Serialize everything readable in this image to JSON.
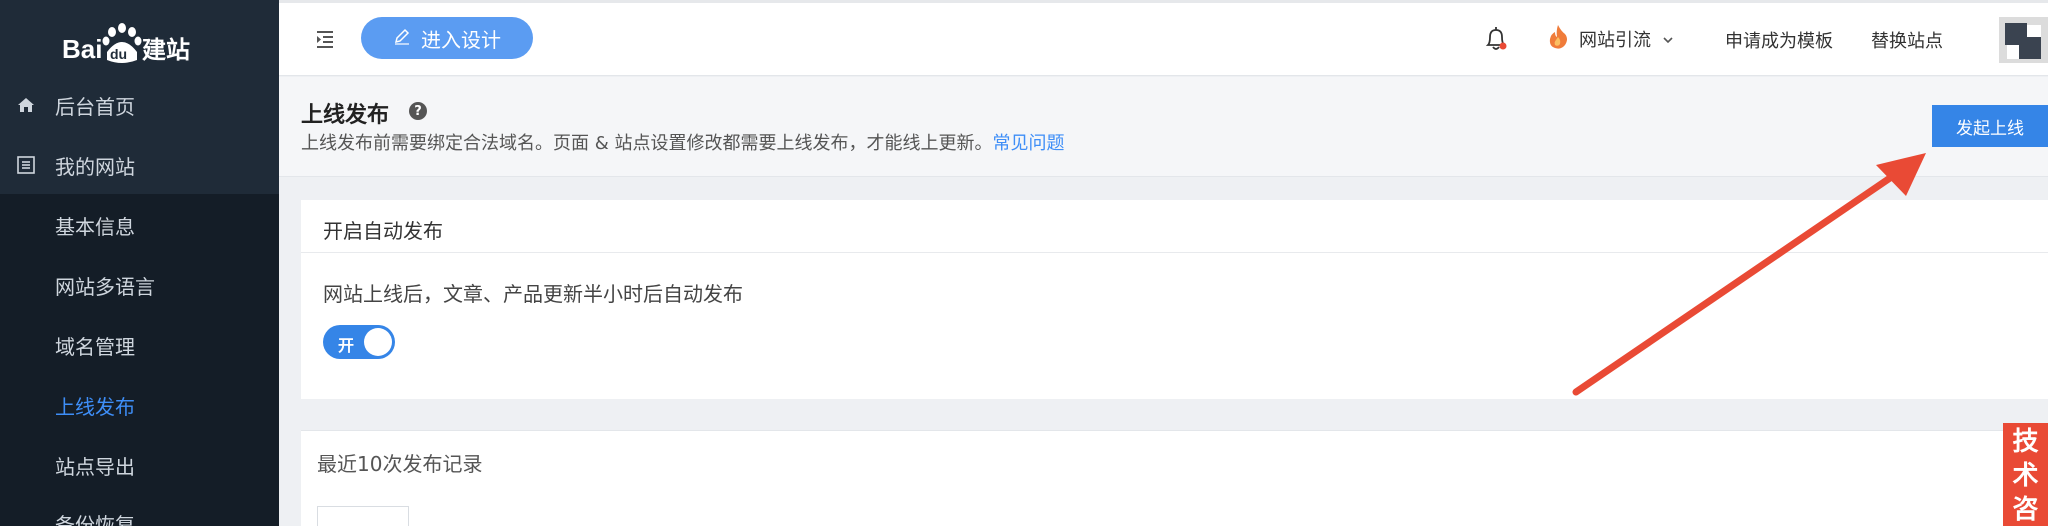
{
  "logo": {
    "text_left": "Bai",
    "text_paw": "du",
    "text_right": "建站"
  },
  "sidebar": {
    "items": [
      {
        "label": "后台首页",
        "icon": "home-icon"
      },
      {
        "label": "我的网站",
        "icon": "list-icon"
      }
    ],
    "subitems": [
      {
        "label": "基本信息"
      },
      {
        "label": "网站多语言"
      },
      {
        "label": "域名管理"
      },
      {
        "label": "上线发布",
        "active": true
      },
      {
        "label": "站点导出"
      },
      {
        "label": "备份恢复"
      }
    ]
  },
  "topbar": {
    "design_button": "进入设计",
    "traffic_label": "网站引流",
    "apply_template": "申请成为模板",
    "switch_site": "替换站点"
  },
  "page": {
    "title": "上线发布",
    "description": "上线发布前需要绑定合法域名。页面 & 站点设置修改都需要上线发布，才能线上更新。",
    "faq_link": "常见问题",
    "publish_button": "发起上线"
  },
  "auto_publish": {
    "title": "开启自动发布",
    "description": "网站上线后，文章、产品更新半小时后自动发布",
    "toggle_label": "开",
    "enabled": true
  },
  "history": {
    "title": "最近10次发布记录"
  },
  "consult": {
    "text": "技术咨"
  },
  "colors": {
    "sidebar_bg": "#1f2b38",
    "primary": "#3585e7",
    "link": "#3e8ef7",
    "arrow": "#e94a35"
  }
}
